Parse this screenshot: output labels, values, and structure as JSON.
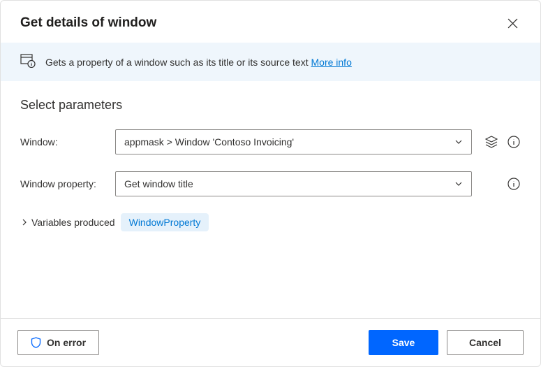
{
  "dialog": {
    "title": "Get details of window"
  },
  "banner": {
    "text": "Gets a property of a window such as its title or its source text ",
    "link": "More info"
  },
  "section": {
    "title": "Select parameters"
  },
  "fields": {
    "window": {
      "label": "Window:",
      "value": "appmask > Window 'Contoso Invoicing'"
    },
    "property": {
      "label": "Window property:",
      "value": "Get window title"
    }
  },
  "variables": {
    "label": "Variables produced",
    "chip": "WindowProperty"
  },
  "footer": {
    "onError": "On error",
    "save": "Save",
    "cancel": "Cancel"
  }
}
